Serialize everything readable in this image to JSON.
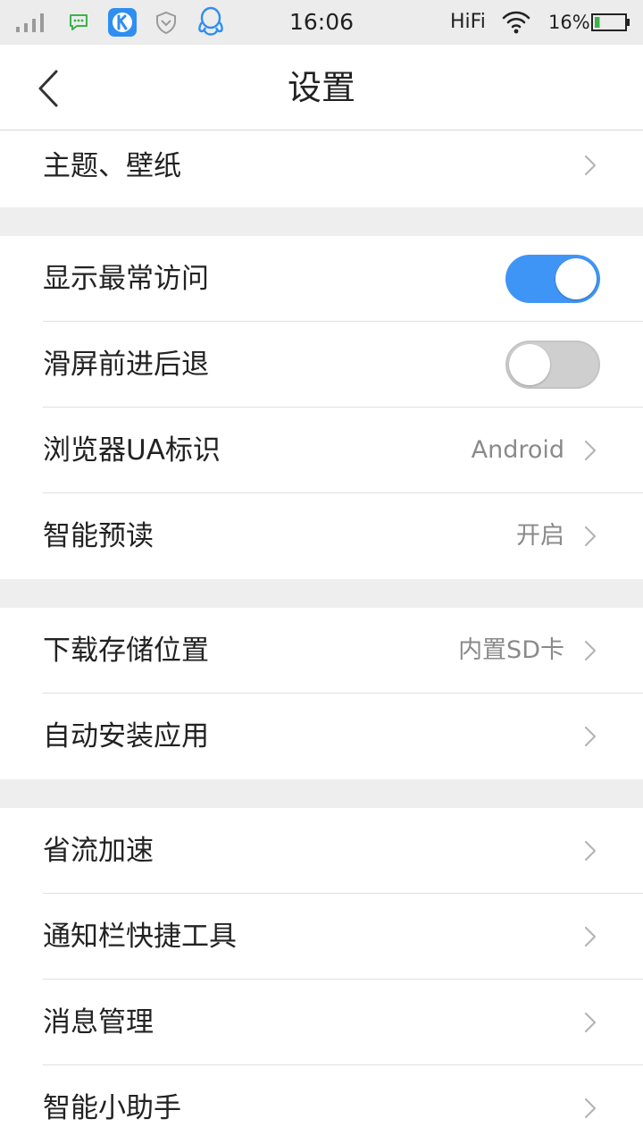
{
  "status_bar": {
    "time": "16:06",
    "network_label": "HiFi",
    "battery_percent": "16%",
    "battery_level": 0.16,
    "icons": [
      "signal-icon",
      "chat-icon",
      "k-app-icon",
      "shield-icon",
      "qq-icon",
      "wifi-icon",
      "battery-icon"
    ]
  },
  "header": {
    "title": "设置",
    "back_icon": "chevron-left-icon"
  },
  "sections": [
    [
      {
        "label": "主题、壁纸",
        "value": "",
        "control": "chevron"
      }
    ],
    [
      {
        "label": "显示最常访问",
        "control": "toggle",
        "on": true
      },
      {
        "label": "滑屏前进后退",
        "control": "toggle",
        "on": false
      },
      {
        "label": "浏览器UA标识",
        "value": "Android",
        "control": "chevron"
      },
      {
        "label": "智能预读",
        "value": "开启",
        "control": "chevron"
      }
    ],
    [
      {
        "label": "下载存储位置",
        "value": "内置SD卡",
        "control": "chevron"
      },
      {
        "label": "自动安装应用",
        "value": "",
        "control": "chevron"
      }
    ],
    [
      {
        "label": "省流加速",
        "value": "",
        "control": "chevron"
      },
      {
        "label": "通知栏快捷工具",
        "value": "",
        "control": "chevron"
      },
      {
        "label": "消息管理",
        "value": "",
        "control": "chevron"
      },
      {
        "label": "智能小助手",
        "value": "",
        "control": "chevron"
      }
    ]
  ],
  "colors": {
    "accent": "#3f95f5",
    "status_bar_bg": "#ececec",
    "section_gap": "#eeeeee",
    "secondary_text": "#8a8a8a"
  }
}
